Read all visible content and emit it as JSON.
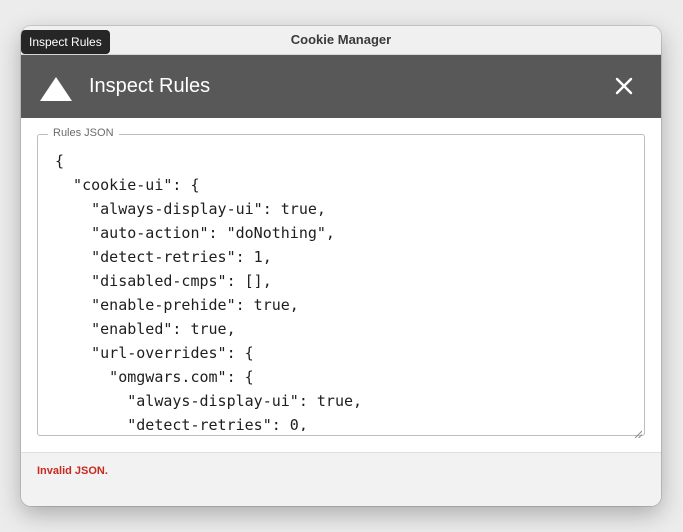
{
  "window": {
    "title": "Cookie Manager"
  },
  "header": {
    "title": "Inspect Rules",
    "tooltip": "Inspect Rules"
  },
  "editor": {
    "legend": "Rules JSON",
    "content": "{\n  \"cookie-ui\": {\n    \"always-display-ui\": true,\n    \"auto-action\": \"doNothing\",\n    \"detect-retries\": 1,\n    \"disabled-cmps\": [],\n    \"enable-prehide\": true,\n    \"enabled\": true,\n    \"url-overrides\": {\n      \"omgwars.com\": {\n        \"always-display-ui\": true,\n        \"detect-retries\": 0,"
  },
  "status": {
    "error": "Invalid JSON."
  },
  "colors": {
    "header_bg": "#585858",
    "error": "#c7291e",
    "close": "#fe5f57",
    "minimize": "#febc2e",
    "maximize": "#28c840"
  },
  "icons": {
    "logo": "warning-triangle-icon",
    "close": "close-icon"
  }
}
